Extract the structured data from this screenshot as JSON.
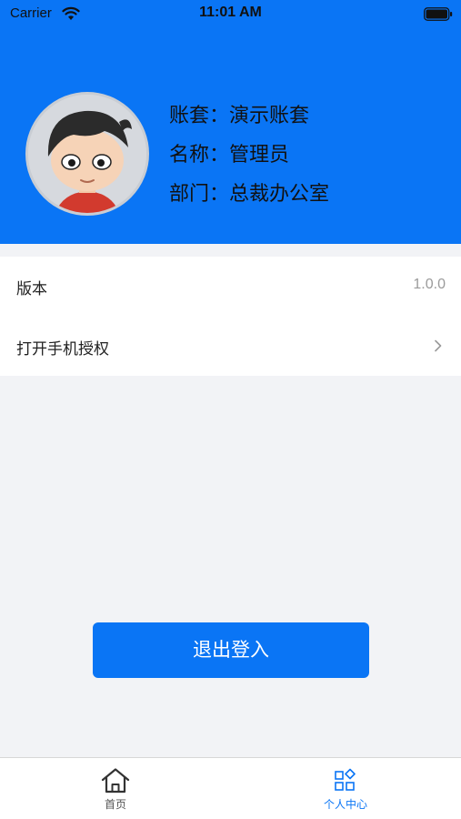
{
  "status_bar": {
    "carrier": "Carrier",
    "time": "11:01 AM",
    "icons": [
      "wifi-icon",
      "battery-icon"
    ]
  },
  "profile": {
    "avatar": "avatar-cartoon-boy",
    "account_label": "账套",
    "account_value": "演示账套",
    "name_label": "名称",
    "name_value": "管理员",
    "dept_label": "部门",
    "dept_value": "总裁办公室",
    "separator": "："
  },
  "settings": {
    "items": [
      {
        "label": "版本",
        "value": "1.0.0"
      },
      {
        "label": "打开手机授权",
        "icon": "chevron-right-icon"
      }
    ]
  },
  "logout_button": {
    "label": "退出登入"
  },
  "tab_bar": {
    "tabs": [
      {
        "label": "首页",
        "icon": "home-icon",
        "active": false
      },
      {
        "label": "个人中心",
        "icon": "grid-apps-icon",
        "active": true
      }
    ]
  },
  "colors": {
    "primary": "#0a75f5",
    "background": "#f2f3f6",
    "list_background": "#ffffff",
    "muted_text": "#9a9a9a"
  }
}
